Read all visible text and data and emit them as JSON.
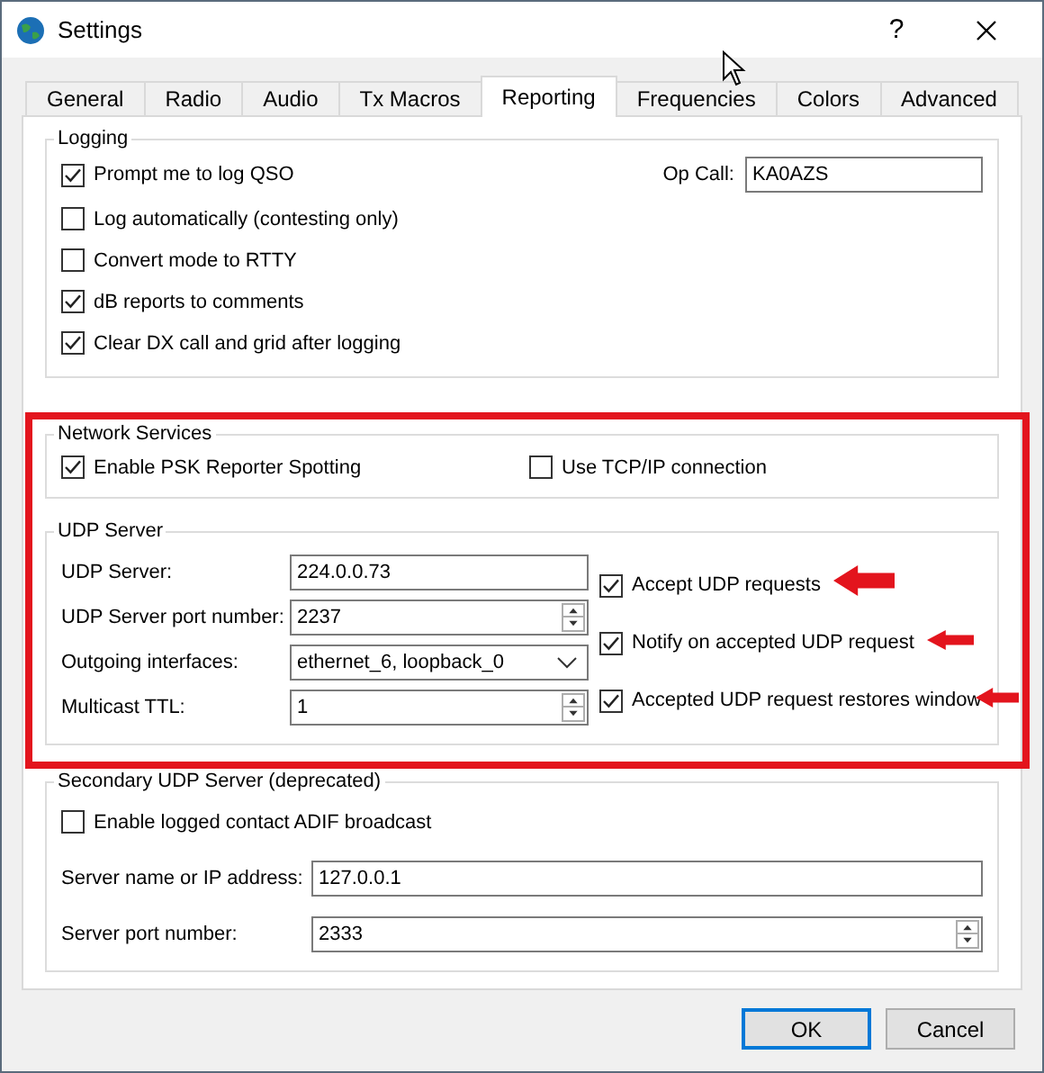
{
  "window": {
    "title": "Settings",
    "help": "?"
  },
  "tabs": [
    {
      "label": "General",
      "selected": false
    },
    {
      "label": "Radio",
      "selected": false
    },
    {
      "label": "Audio",
      "selected": false
    },
    {
      "label": "Tx Macros",
      "selected": false
    },
    {
      "label": "Reporting",
      "selected": true
    },
    {
      "label": "Frequencies",
      "selected": false
    },
    {
      "label": "Colors",
      "selected": false
    },
    {
      "label": "Advanced",
      "selected": false
    }
  ],
  "logging": {
    "title": "Logging",
    "options": [
      {
        "label": "Prompt me to log QSO",
        "checked": true
      },
      {
        "label": "Log automatically (contesting only)",
        "checked": false
      },
      {
        "label": "Convert mode to RTTY",
        "checked": false
      },
      {
        "label": "dB reports to comments",
        "checked": true
      },
      {
        "label": "Clear DX call and grid after logging",
        "checked": true
      }
    ],
    "op_call": {
      "label": "Op Call:",
      "value": "KA0AZS"
    }
  },
  "network_services": {
    "title": "Network Services",
    "options": [
      {
        "label": "Enable PSK Reporter Spotting",
        "checked": true
      },
      {
        "label": "Use TCP/IP connection",
        "checked": false
      }
    ]
  },
  "udp_server": {
    "title": "UDP Server",
    "fields": [
      {
        "kind": "text",
        "label": "UDP Server:",
        "value": "224.0.0.73"
      },
      {
        "kind": "spin",
        "label": "UDP Server port number:",
        "value": "2237"
      },
      {
        "kind": "combo",
        "label": "Outgoing interfaces:",
        "value": "ethernet_6, loopback_0"
      },
      {
        "kind": "spin",
        "label": "Multicast TTL:",
        "value": "1"
      }
    ],
    "options": [
      {
        "label": "Accept UDP requests",
        "checked": true
      },
      {
        "label": "Notify on accepted UDP request",
        "checked": true
      },
      {
        "label": "Accepted UDP request restores window",
        "checked": true
      }
    ]
  },
  "secondary_udp_server": {
    "title": "Secondary UDP Server (deprecated)",
    "options": [
      {
        "label": "Enable logged contact ADIF broadcast",
        "checked": false
      }
    ],
    "fields": [
      {
        "kind": "text",
        "label": "Server name or IP address:",
        "value": "127.0.0.1"
      },
      {
        "kind": "spin",
        "label": "Server port number:",
        "value": "2333"
      }
    ]
  },
  "buttons": [
    {
      "label": "OK",
      "default": true
    },
    {
      "label": "Cancel",
      "default": false
    }
  ]
}
